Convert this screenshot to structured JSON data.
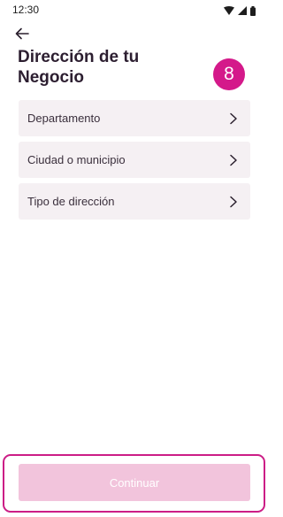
{
  "status_bar": {
    "time": "12:30",
    "icons": [
      "wifi-icon",
      "signal-icon",
      "battery-icon"
    ]
  },
  "header": {
    "back_icon": "arrow-left-icon",
    "title": "Dirección de tu Negocio",
    "step_number": "8"
  },
  "options": [
    {
      "label": "Departamento",
      "icon": "chevron-right-icon"
    },
    {
      "label": "Ciudad o municipio",
      "icon": "chevron-right-icon"
    },
    {
      "label": "Tipo de dirección",
      "icon": "chevron-right-icon"
    }
  ],
  "footer": {
    "continue_label": "Continuar",
    "continue_disabled": true
  },
  "colors": {
    "accent": "#d4198a",
    "option_background": "#f5f0f3",
    "button_disabled": "#f2c4dc",
    "frame_border": "#cc1d86"
  }
}
